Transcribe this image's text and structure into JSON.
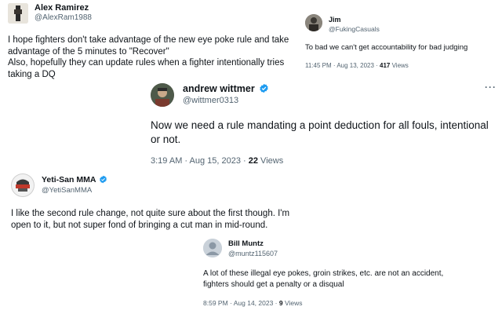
{
  "tweet1": {
    "name": "Alex Ramirez",
    "handle": "@AlexRam1988",
    "lines": [
      "I hope fighters don't take advantage of the new eye poke rule and take",
      "advantage of the 5 minutes to \"Recover\"",
      "Also, hopefully they can update rules when a fighter intentionally tries",
      "taking a DQ"
    ]
  },
  "tweet2": {
    "name": "Jim",
    "handle": "@FukingCasuals",
    "text": "To bad we can't get accountability for bad judging",
    "time": "11:45 PM · Aug 13, 2023 · ",
    "views_count": "417",
    "views_label": " Views"
  },
  "tweet3": {
    "name": "andrew wittmer",
    "handle": "@wittmer0313",
    "lines": [
      "Now we need a rule mandating a point deduction for all fouls, intentional",
      "or not."
    ],
    "time": "3:19 AM · Aug 15, 2023 · ",
    "views_count": "22",
    "views_label": " Views",
    "more": "···"
  },
  "tweet4": {
    "name": "Yeti-San MMA",
    "handle": "@YetiSanMMA",
    "lines": [
      "I like the second rule change, not quite sure about the first though. I'm",
      "open to it, but not super fond of bringing a cut man in mid-round."
    ]
  },
  "tweet5": {
    "name": "Bill Muntz",
    "handle": "@muntz115607",
    "lines": [
      "A lot of these illegal eye pokes, groin strikes, etc. are not an accident,",
      "fighters should get a penalty or a disqual"
    ],
    "time": "8:59 PM · Aug 14, 2023 · ",
    "views_count": "9",
    "views_label": " Views"
  },
  "colors": {
    "verified": "#1d9bf0",
    "secondary_text": "#536471",
    "primary_text": "#0f1419"
  }
}
